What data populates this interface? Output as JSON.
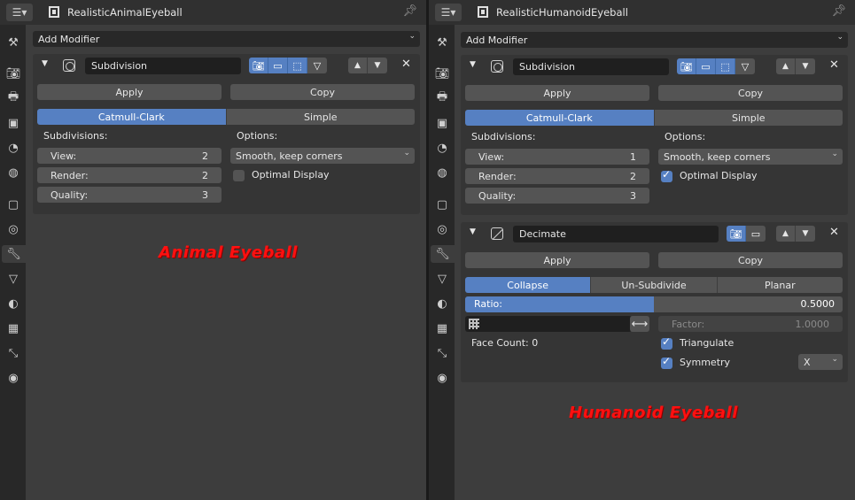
{
  "colors": {
    "accent": "#5680c2",
    "caption": "#ff1010",
    "panel_bg": "#3d3d3d"
  },
  "left": {
    "object_name": "RealisticAnimalEyeball",
    "add_modifier": "Add Modifier",
    "caption": "Animal Eyeball",
    "subdivision": {
      "name": "Subdivision",
      "apply": "Apply",
      "copy": "Copy",
      "modes": [
        "Catmull-Clark",
        "Simple"
      ],
      "subdivisions_label": "Subdivisions:",
      "view_label": "View:",
      "view_value": "2",
      "render_label": "Render:",
      "render_value": "2",
      "quality_label": "Quality:",
      "quality_value": "3",
      "options_label": "Options:",
      "uv_smooth": "Smooth, keep corners",
      "optimal_display": "Optimal Display",
      "optimal_display_checked": false
    }
  },
  "right": {
    "object_name": "RealisticHumanoidEyeball",
    "add_modifier": "Add Modifier",
    "caption": "Humanoid Eyeball",
    "subdivision": {
      "name": "Subdivision",
      "apply": "Apply",
      "copy": "Copy",
      "modes": [
        "Catmull-Clark",
        "Simple"
      ],
      "subdivisions_label": "Subdivisions:",
      "view_label": "View:",
      "view_value": "1",
      "render_label": "Render:",
      "render_value": "2",
      "quality_label": "Quality:",
      "quality_value": "3",
      "options_label": "Options:",
      "uv_smooth": "Smooth, keep corners",
      "optimal_display": "Optimal Display",
      "optimal_display_checked": true
    },
    "decimate": {
      "name": "Decimate",
      "apply": "Apply",
      "copy": "Copy",
      "modes": [
        "Collapse",
        "Un-Subdivide",
        "Planar"
      ],
      "ratio_label": "Ratio:",
      "ratio_value": "0.5000",
      "ratio_fraction": 0.5,
      "factor_label": "Factor:",
      "factor_value": "1.0000",
      "face_count": "Face Count: 0",
      "triangulate": "Triangulate",
      "triangulate_checked": true,
      "symmetry": "Symmetry",
      "symmetry_checked": true,
      "symmetry_axis": "X"
    }
  },
  "icons": {
    "tabs": [
      "tool-icon",
      "render-icon",
      "output-icon",
      "view-layer-icon",
      "scene-icon",
      "world-icon",
      "object-icon",
      "physics-icon",
      "modifier-icon",
      "particles-icon",
      "shading-icon",
      "texture-icon",
      "constraints-icon",
      "data-icon"
    ]
  }
}
